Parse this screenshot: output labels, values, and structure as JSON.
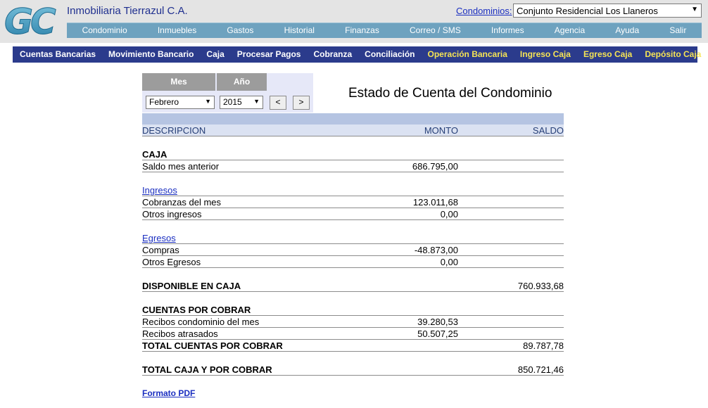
{
  "header": {
    "logo_text": "GC",
    "company": "Inmobiliaria Tierrazul C.A.",
    "condominio_label": "Condominios:",
    "condominio_selected": "Conjunto Residencial Los Llaneros"
  },
  "main_nav": [
    "Condominio",
    "Inmuebles",
    "Gastos",
    "Historial",
    "Finanzas",
    "Correo / SMS",
    "Informes",
    "Agencia",
    "Ayuda",
    "Salir"
  ],
  "sub_nav": [
    {
      "label": "Cuentas Bancarias",
      "highlight": false
    },
    {
      "label": "Movimiento Bancario",
      "highlight": false
    },
    {
      "label": "Caja",
      "highlight": false
    },
    {
      "label": "Procesar Pagos",
      "highlight": false
    },
    {
      "label": "Cobranza",
      "highlight": false
    },
    {
      "label": "Conciliación",
      "highlight": false
    },
    {
      "label": "Operación Bancaria",
      "highlight": true
    },
    {
      "label": "Ingreso Caja",
      "highlight": true
    },
    {
      "label": "Egreso Caja",
      "highlight": true
    },
    {
      "label": "Depósito Caja",
      "highlight": true
    }
  ],
  "period": {
    "mes_label": "Mes",
    "anio_label": "Año",
    "mes_value": "Febrero",
    "anio_value": "2015",
    "prev": "<",
    "next": ">"
  },
  "report": {
    "title": "Estado de Cuenta del Condominio",
    "columns": {
      "desc": "DESCRIPCION",
      "monto": "MONTO",
      "saldo": "SALDO"
    },
    "rows": [
      {
        "type": "blank"
      },
      {
        "type": "section",
        "desc": "CAJA"
      },
      {
        "desc": "Saldo mes anterior",
        "monto": "686.795,00"
      },
      {
        "type": "blank"
      },
      {
        "type": "link",
        "desc": "Ingresos"
      },
      {
        "desc": "Cobranzas del mes",
        "monto": "123.011,68"
      },
      {
        "desc": "Otros ingresos",
        "monto": "0,00"
      },
      {
        "type": "blank"
      },
      {
        "type": "link",
        "desc": "Egresos"
      },
      {
        "desc": "Compras",
        "monto": "-48.873,00"
      },
      {
        "desc": "Otros Egresos",
        "monto": "0,00"
      },
      {
        "type": "blank"
      },
      {
        "type": "total",
        "desc": "DISPONIBLE EN CAJA",
        "saldo": "760.933,68"
      },
      {
        "type": "blank"
      },
      {
        "type": "section",
        "desc": "CUENTAS POR COBRAR"
      },
      {
        "desc": "Recibos condominio del mes",
        "monto": "39.280,53"
      },
      {
        "desc": "Recibos atrasados",
        "monto": "50.507,25"
      },
      {
        "type": "total",
        "desc": "TOTAL CUENTAS POR COBRAR",
        "saldo": "89.787,78"
      },
      {
        "type": "blank"
      },
      {
        "type": "total",
        "desc": "TOTAL CAJA Y POR COBRAR",
        "saldo": "850.721,46"
      },
      {
        "type": "blank"
      }
    ],
    "pdf_link": "Formato PDF"
  },
  "colors": {
    "header_bg": "#e4e4e4",
    "main_nav_bg": "#6ea2bf",
    "sub_nav_bg": "#2b3b8c",
    "sub_nav_highlight": "#f6e454",
    "table_header_bg": "#b5c4e2",
    "link": "#1a2ec0",
    "logo": "#3a9fc3"
  }
}
